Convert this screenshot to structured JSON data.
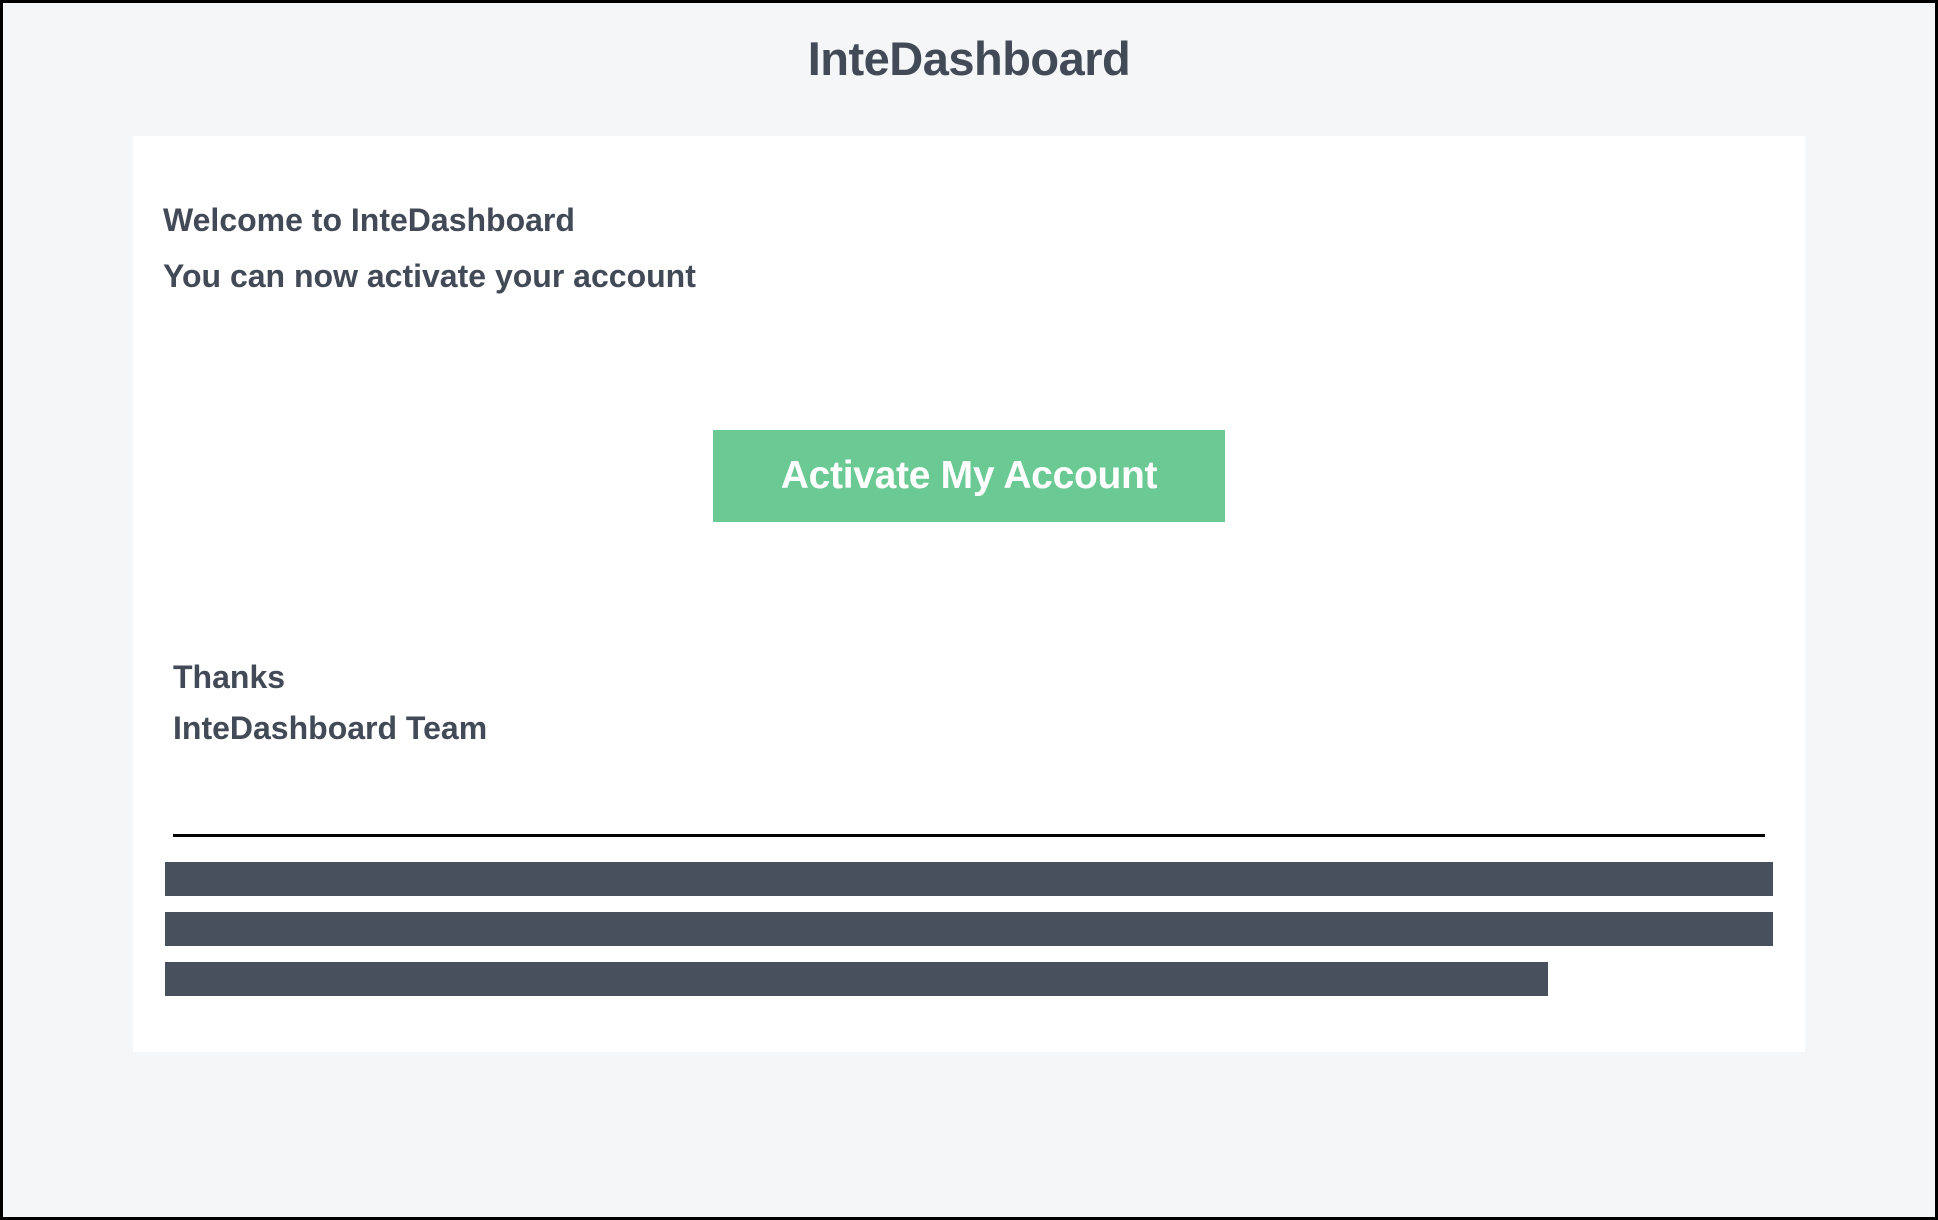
{
  "header": {
    "title": "InteDashboard"
  },
  "body": {
    "welcome": "Welcome to InteDashboard",
    "subtitle": "You can now activate your account",
    "button_label": "Activate My Account",
    "thanks": "Thanks",
    "team": "InteDashboard Team"
  }
}
